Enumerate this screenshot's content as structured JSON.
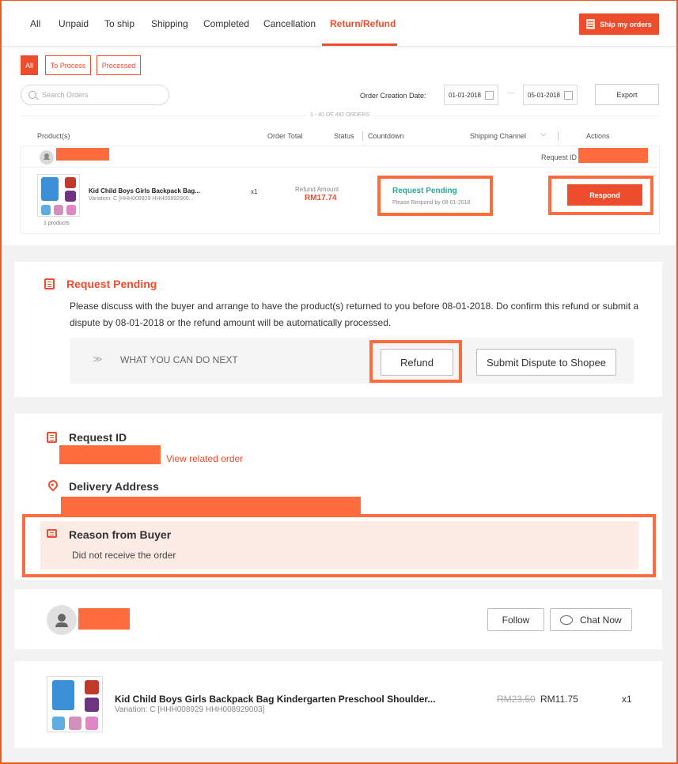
{
  "tabs": [
    "All",
    "Unpaid",
    "To ship",
    "Shipping",
    "Completed",
    "Cancellation",
    "Return/Refund"
  ],
  "active_tab": "Return/Refund",
  "ship_my_orders": "Ship my orders",
  "filters": [
    "All",
    "To Process",
    "Processed"
  ],
  "search_placeholder": "Search Orders",
  "order_creation_date_label": "Order Creation Date:",
  "date_from": "01-01-2018",
  "date_sep": "—",
  "date_to": "05-01-2018",
  "export": "Export",
  "orders_count": "1 - 40 OF 492 ORDERS",
  "columns": {
    "products": "Product(s)",
    "order_total": "Order Total",
    "status": "Status",
    "countdown": "Countdown",
    "shipping_channel": "Shipping Channel",
    "actions": "Actions"
  },
  "order": {
    "request_id_label": "Request ID",
    "product_name": "Kid Child Boys Girls Backpack Bag...",
    "variation": "Variation: C [HHH008929 HHH00892900...",
    "products_count": "1 products",
    "qty": "x1",
    "refund_amount_label": "Refund Amount",
    "refund_amount": "RM17.74",
    "status_title": "Request Pending",
    "status_sub": "Please Respond by 08-01-2018",
    "respond": "Respond"
  },
  "pending_panel": {
    "title": "Request Pending",
    "body": "Please discuss with the buyer and arrange to have the product(s) returned to you before 08-01-2018. Do confirm this refund or submit a dispute by 08-01-2018 or the refund amount will be automatically processed.",
    "next_label": "WHAT YOU CAN DO NEXT",
    "next_arrows": "≫",
    "refund": "Refund",
    "dispute": "Submit Dispute to Shopee"
  },
  "details_panel": {
    "request_id": "Request ID",
    "view_related": "View related order",
    "delivery_address": "Delivery Address",
    "reason_title": "Reason from Buyer",
    "reason_text": "Did not receive the order"
  },
  "buyer_panel": {
    "follow": "Follow",
    "chat_now": "Chat Now"
  },
  "product_panel": {
    "name": "Kid Child Boys Girls Backpack Bag Kindergarten Preschool Shoulder...",
    "variation": "Variation: C [HHH008929 HHH008929003]",
    "old_price": "RM23.50",
    "price": "RM11.75",
    "qty": "x1"
  },
  "colors": {
    "accent": "#ee4d2d",
    "redaction": "#fe6c3d",
    "status_green": "#26aa99"
  }
}
